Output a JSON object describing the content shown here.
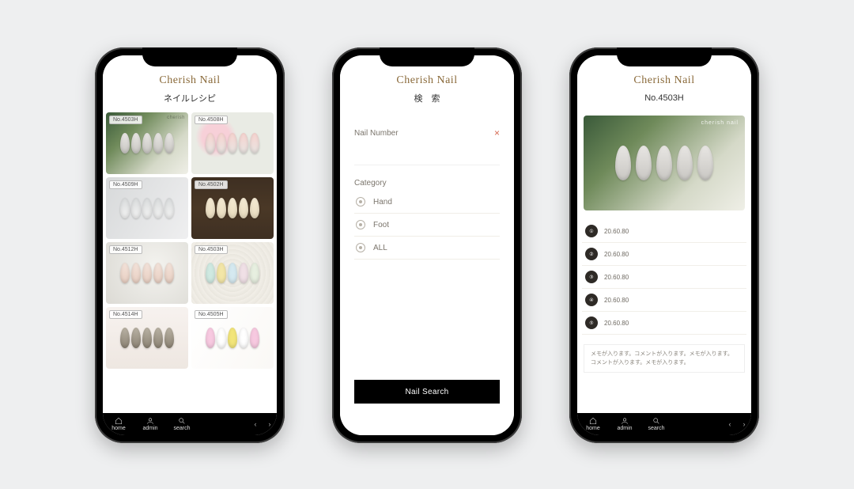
{
  "brand": "Cherish Nail",
  "phone1": {
    "title": "ネイルレシピ",
    "items": [
      {
        "tag": "No.4503H",
        "bg": "bg-plant",
        "col": "c-blushgrey",
        "wm": "cherish"
      },
      {
        "tag": "No.4508H",
        "bg": "bg-flower",
        "col": "c-pinkclear",
        "wm": ""
      },
      {
        "tag": "No.4509H",
        "bg": "bg-grey",
        "col": "c-greywhite",
        "wm": ""
      },
      {
        "tag": "No.4502H",
        "bg": "bg-wood",
        "col": "c-cream",
        "wm": ""
      },
      {
        "tag": "No.4512H",
        "bg": "bg-marble",
        "col": "c-nude",
        "wm": ""
      },
      {
        "tag": "No.4503H",
        "bg": "bg-crochet",
        "col": "c-mint",
        "wm": ""
      },
      {
        "tag": "No.4514H",
        "bg": "bg-soft",
        "col": "c-chrome",
        "wm": ""
      },
      {
        "tag": "No.4505H",
        "bg": "bg-pastel",
        "col": "c-pops",
        "wm": ""
      }
    ],
    "nav": {
      "home": "home",
      "admin": "admin",
      "search": "search"
    }
  },
  "phone2": {
    "title": "検　索",
    "nail_number_label": "Nail Number",
    "close_glyph": "×",
    "category_label": "Category",
    "cats": [
      "Hand",
      "Foot",
      "ALL"
    ],
    "button": "Nail Search"
  },
  "phone3": {
    "title": "No.4503H",
    "hero_wm": "cherish nail",
    "steps": [
      {
        "n": "①",
        "v": "20.60.80"
      },
      {
        "n": "②",
        "v": "20.60.80"
      },
      {
        "n": "③",
        "v": "20.60.80"
      },
      {
        "n": "④",
        "v": "20.60.80"
      },
      {
        "n": "⑤",
        "v": "20.60.80"
      }
    ],
    "memo": "メモが入ります。コメントが入ります。メモが入ります。コメントが入ります。メモが入ります。",
    "nav": {
      "home": "home",
      "admin": "admin",
      "search": "search"
    }
  }
}
